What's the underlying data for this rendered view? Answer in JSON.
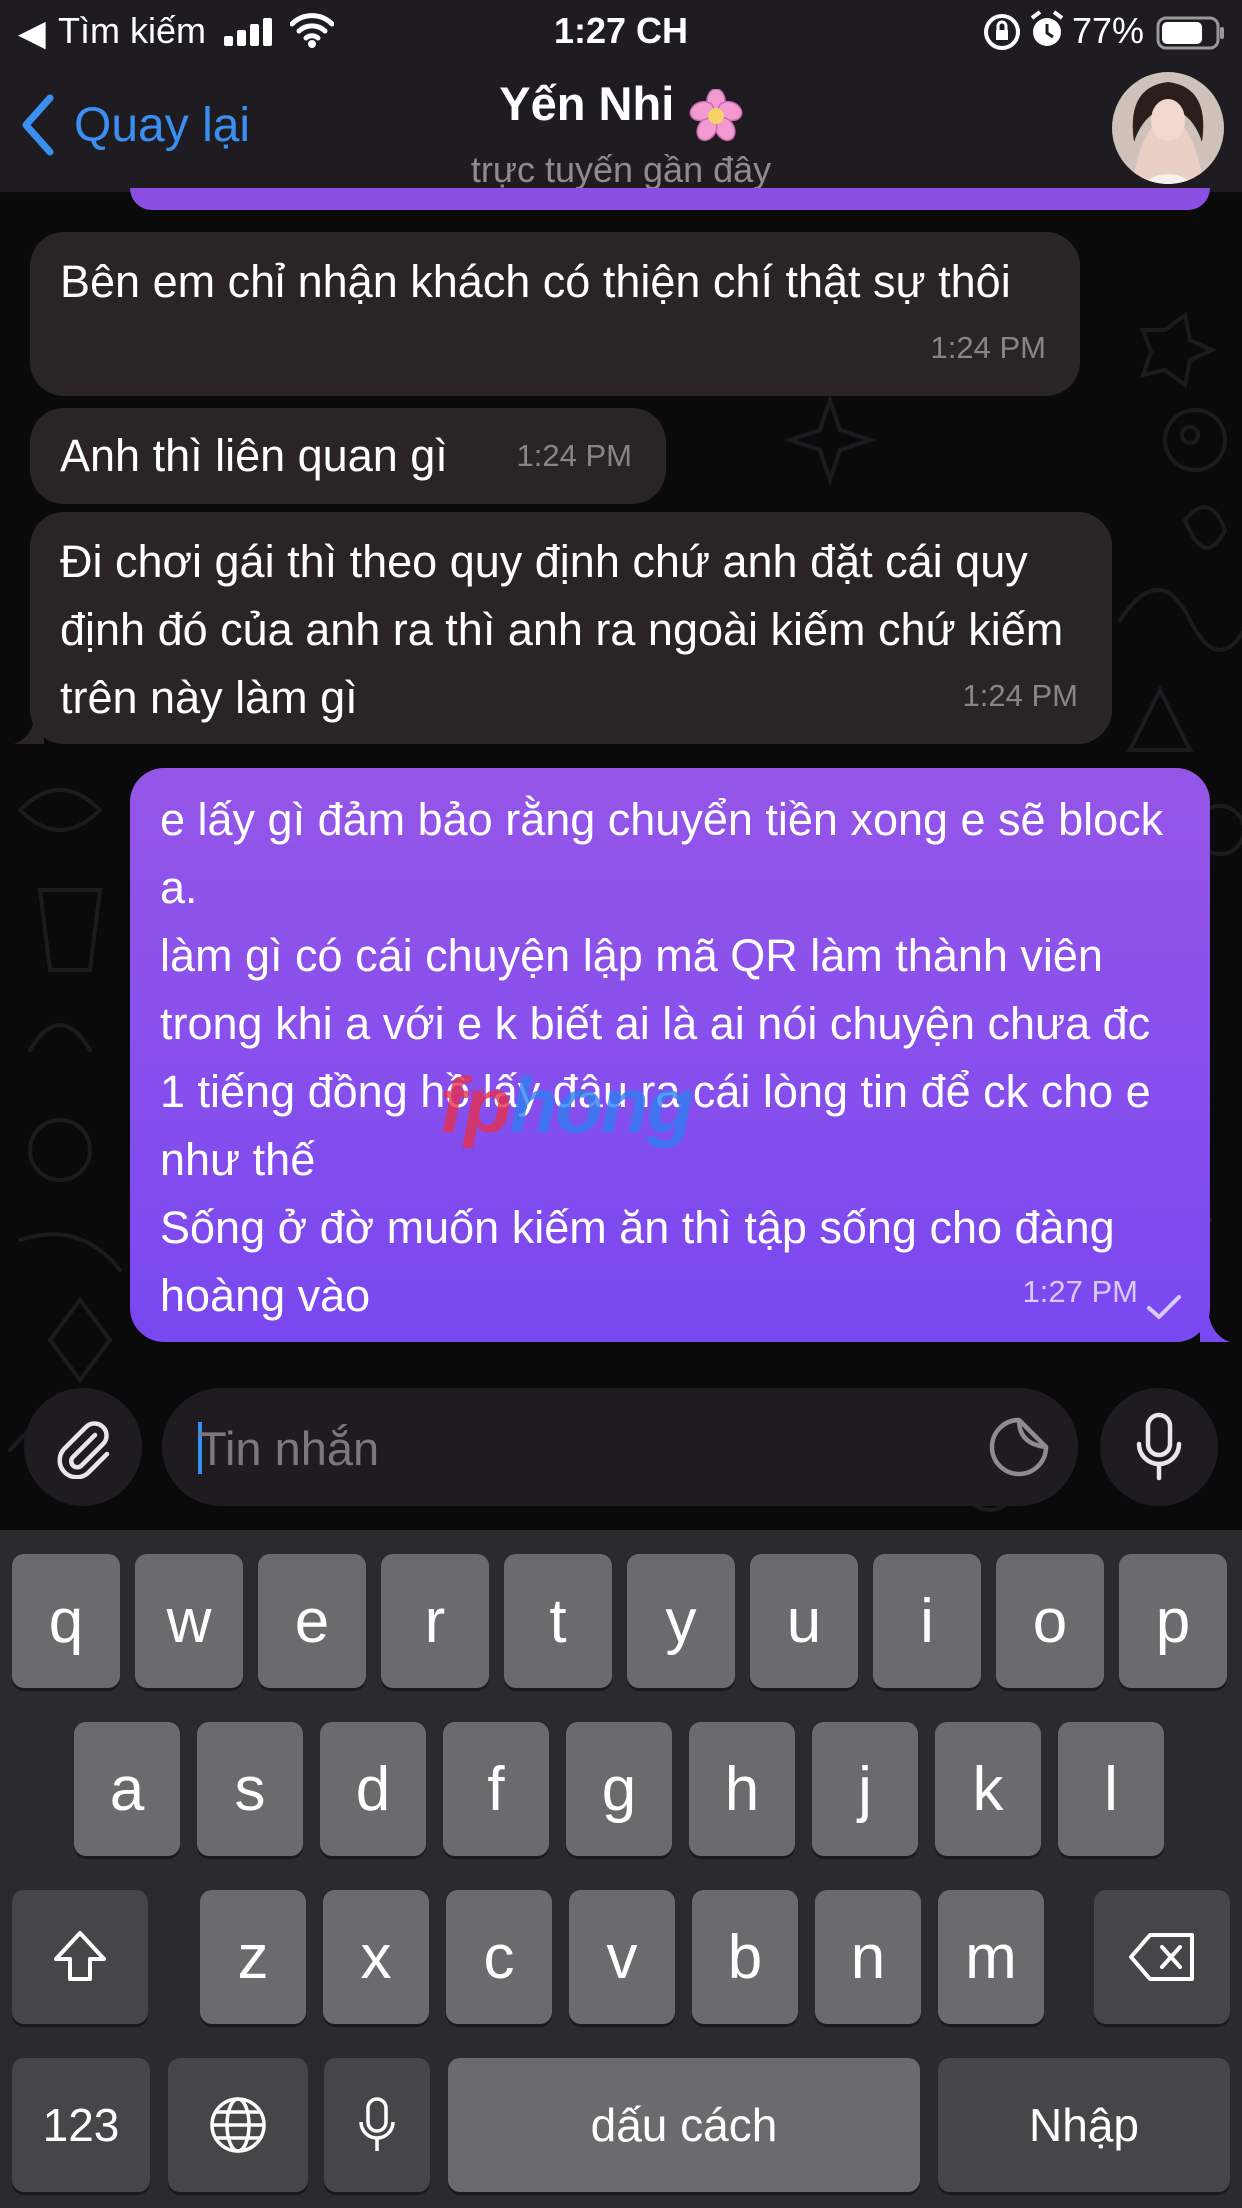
{
  "status_bar": {
    "back_glyph": "◀",
    "carrier": "Tìm kiếm",
    "time": "1:27 CH",
    "battery_percent": "77%",
    "battery_level": 0.77,
    "icons": [
      "back-arrow-icon",
      "signal-icon",
      "wifi-icon",
      "orientation-lock-icon",
      "alarm-icon",
      "battery-icon"
    ]
  },
  "header": {
    "back_label": "Quay lại",
    "contact_name": "Yến Nhi",
    "contact_status": "trực tuyến gần đây",
    "name_emoji_icon": "flower-icon",
    "avatar_icon": "avatar-icon"
  },
  "messages": [
    {
      "direction": "in",
      "text": "Bên em chỉ nhận khách có thiện chí thật sự thôi",
      "time": "1:24 PM"
    },
    {
      "direction": "in",
      "text": "Anh thì liên quan gì",
      "time": "1:24 PM"
    },
    {
      "direction": "in",
      "text": "Đi chơi gái thì theo quy định chứ anh đặt cái quy định đó của anh ra thì anh ra ngoài kiếm chứ kiếm trên này làm gì",
      "time": "1:24 PM"
    },
    {
      "direction": "out",
      "text": "e lấy gì đảm bảo rằng chuyển tiền xong e sẽ block a.\nlàm gì có cái chuyện lập mã QR làm thành viên trong khi a với e k biết ai là ai nói chuyện chưa đc 1 tiếng đồng hồ lấy đâu ra cái lòng tin để ck cho e như thế\nSống ở đờ muốn kiếm ăn thì tập sống cho đàng hoàng vào",
      "time": "1:27 PM",
      "status_icon": "checkmark-icon"
    }
  ],
  "watermark": {
    "part1": "fp",
    "part2": "hong"
  },
  "composer": {
    "placeholder": "Tin nhắn",
    "value": "",
    "attach_icon": "paperclip-icon",
    "sticker_icon": "sticker-icon",
    "mic_icon": "microphone-icon"
  },
  "keyboard": {
    "row1": [
      "q",
      "w",
      "e",
      "r",
      "t",
      "y",
      "u",
      "i",
      "o",
      "p"
    ],
    "row2": [
      "a",
      "s",
      "d",
      "f",
      "g",
      "h",
      "j",
      "k",
      "l"
    ],
    "row3": [
      "z",
      "x",
      "c",
      "v",
      "b",
      "n",
      "m"
    ],
    "numbers_label": "123",
    "space_label": "dấu cách",
    "return_label": "Nhập",
    "icons": [
      "shift-icon",
      "backspace-icon",
      "globe-icon",
      "dictation-mic-icon"
    ]
  },
  "colors": {
    "accent": "#3b8ff0",
    "outgoing_bubble_top": "#9556e8",
    "outgoing_bubble_bottom": "#7a48f0",
    "incoming_bubble": "#2b2427",
    "header_bg": "#1f1c21",
    "keyboard_bg": "#2b2b2e",
    "key_bg": "#6b6b6e"
  }
}
